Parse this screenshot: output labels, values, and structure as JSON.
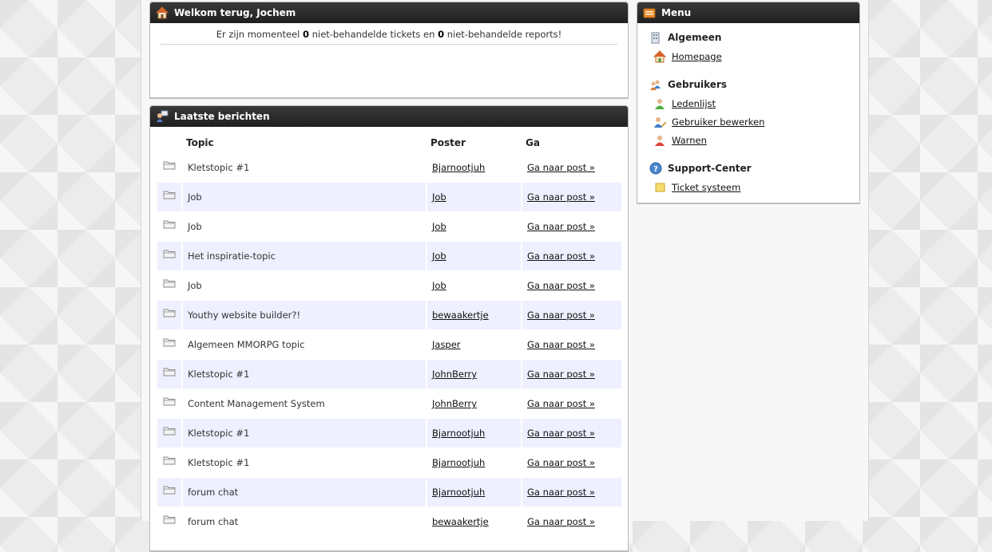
{
  "welcome": {
    "title": "Welkom terug, Jochem",
    "msg_pre": "Er zijn momenteel ",
    "tickets": "0",
    "msg_mid": " niet-behandelde tickets en ",
    "reports": "0",
    "msg_post": " niet-behandelde reports!"
  },
  "posts": {
    "title": "Laatste berichten",
    "columns": {
      "topic": "Topic",
      "poster": "Poster",
      "go": "Ga"
    },
    "rows": [
      {
        "topic": "Kletstopic #1",
        "poster": "Bjarnootjuh",
        "go": "Ga naar post »"
      },
      {
        "topic": "Job",
        "poster": "Job",
        "go": "Ga naar post »"
      },
      {
        "topic": "Job",
        "poster": "Job",
        "go": "Ga naar post »"
      },
      {
        "topic": "Het inspiratie-topic",
        "poster": "Job",
        "go": "Ga naar post »"
      },
      {
        "topic": "Job",
        "poster": "Job",
        "go": "Ga naar post »"
      },
      {
        "topic": "Youthy website builder?!",
        "poster": "bewaakertje",
        "go": "Ga naar post »"
      },
      {
        "topic": "Algemeen MMORPG topic",
        "poster": "Jasper",
        "go": "Ga naar post »"
      },
      {
        "topic": "Kletstopic #1",
        "poster": "JohnBerry",
        "go": "Ga naar post »"
      },
      {
        "topic": "Content Management System",
        "poster": "JohnBerry",
        "go": "Ga naar post »"
      },
      {
        "topic": "Kletstopic #1",
        "poster": "Bjarnootjuh",
        "go": "Ga naar post »"
      },
      {
        "topic": "Kletstopic #1",
        "poster": "Bjarnootjuh",
        "go": "Ga naar post »"
      },
      {
        "topic": "forum chat",
        "poster": "Bjarnootjuh",
        "go": "Ga naar post »"
      },
      {
        "topic": "forum chat",
        "poster": "bewaakertje",
        "go": "Ga naar post »"
      }
    ]
  },
  "menu": {
    "title": "Menu",
    "algemeen": {
      "label": "Algemeen",
      "homepage": "Homepage"
    },
    "gebruikers": {
      "label": "Gebruikers",
      "ledenlijst": "Ledenlijst",
      "bewerken": "Gebruiker bewerken",
      "warnen": "Warnen"
    },
    "support": {
      "label": "Support-Center",
      "tickets": "Ticket systeem"
    }
  }
}
